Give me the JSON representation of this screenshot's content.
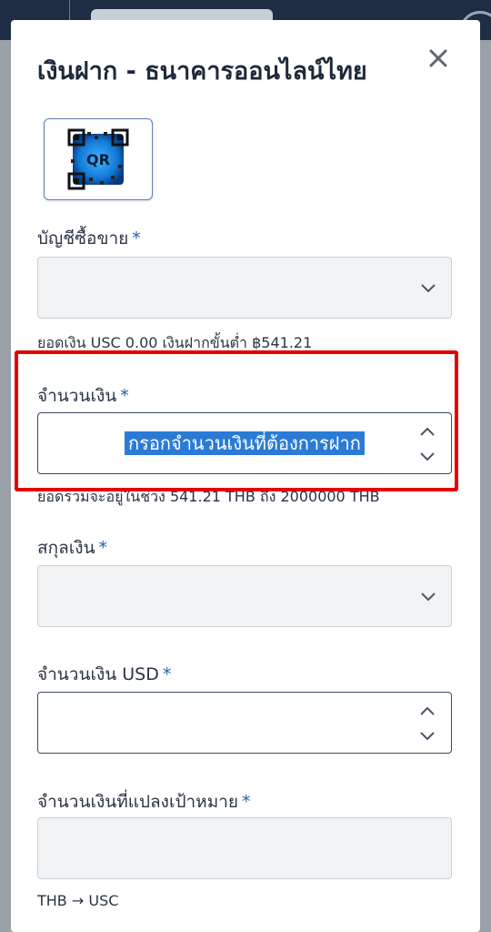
{
  "modal": {
    "title": "เงินฝาก - ธนาคารออนไลน์ไทย",
    "qr_label": "QR"
  },
  "fields": {
    "trading_account": {
      "label": "บัญชีซื้อขาย",
      "required": "*",
      "helper": "ยอดเงิน USC 0.00 เงินฝากขั้นต่ำ ฿541.21"
    },
    "amount": {
      "label": "จำนวนเงิน",
      "required": "*",
      "placeholder": "กรอกจำนวนเงินที่ต้องการฝาก",
      "helper": "ยอดรวมจะอยู่ในช่วง 541.21 THB ถึง 2000000 THB"
    },
    "currency": {
      "label": "สกุลเงิน",
      "required": "*"
    },
    "amount_usd": {
      "label": "จำนวนเงิน USD",
      "required": "*"
    },
    "converted_amount": {
      "label": "จำนวนเงินที่แปลงเป้าหมาย",
      "required": "*",
      "helper": "THB → USC"
    }
  },
  "colors": {
    "accent": "#1f5fb0",
    "highlight": "#2b7bd6",
    "annotation": "#e40000"
  }
}
